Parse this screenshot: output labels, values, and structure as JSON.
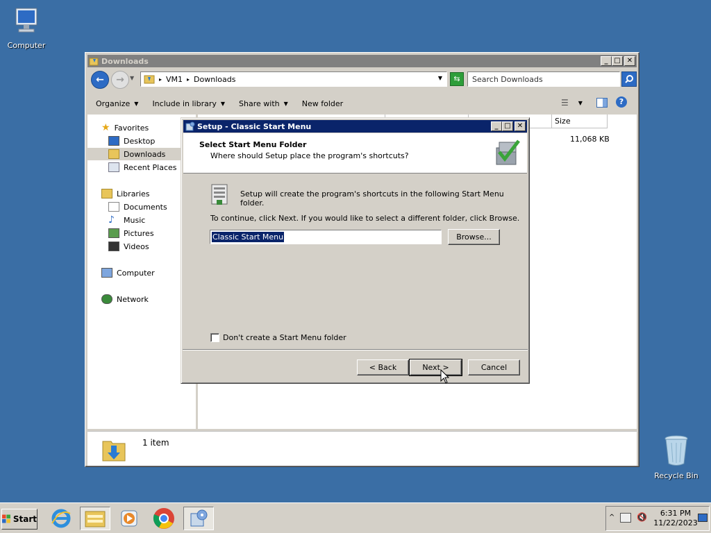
{
  "desktop": {
    "computer_label": "Computer",
    "recycle_label": "Recycle Bin"
  },
  "explorer": {
    "title": "Downloads",
    "breadcrumb": [
      "VM1",
      "Downloads"
    ],
    "search_placeholder": "Search Downloads",
    "toolbar": {
      "organize": "Organize",
      "include": "Include in library",
      "share": "Share with",
      "new_folder": "New folder"
    },
    "nav": {
      "favorites": "Favorites",
      "desktop": "Desktop",
      "downloads": "Downloads",
      "recent": "Recent Places",
      "libraries": "Libraries",
      "documents": "Documents",
      "music": "Music",
      "pictures": "Pictures",
      "videos": "Videos",
      "computer": "Computer",
      "network": "Network"
    },
    "columns": {
      "size": "Size"
    },
    "file_size": "11,068 KB",
    "status": "1 item"
  },
  "dialog": {
    "title": "Setup - Classic Start Menu",
    "heading": "Select Start Menu Folder",
    "subheading": "Where should Setup place the program's shortcuts?",
    "info": "Setup will create the program's shortcuts in the following Start Menu folder.",
    "instruction": "To continue, click Next. If you would like to select a different folder, click Browse.",
    "folder_value": "Classic Start Menu",
    "browse_label": "Browse...",
    "checkbox_label": "Don't create a Start Menu folder",
    "back_label": "< Back",
    "next_label": "Next >",
    "cancel_label": "Cancel"
  },
  "taskbar": {
    "start_label": "Start",
    "time": "6:31 PM",
    "date": "11/22/2023"
  },
  "colors": {
    "desktop": "#3a6ea5",
    "titlebar_active": "#0a246a",
    "titlebar_inactive": "#808080",
    "face": "#d4d0c8"
  }
}
